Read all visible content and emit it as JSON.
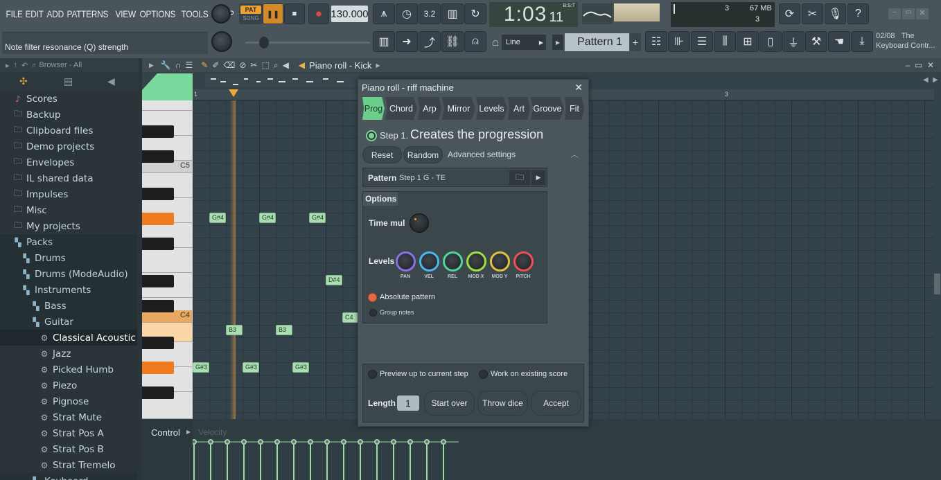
{
  "menu": [
    "FILE",
    "EDIT",
    "ADD",
    "PATTERNS",
    "VIEW",
    "OPTIONS",
    "TOOLS",
    "HELP"
  ],
  "transport": {
    "mode_pat": "PAT",
    "mode_song": "SONG",
    "tempo": "130.000",
    "time": "1:03",
    "time_small": "11",
    "bst": "B:S:T"
  },
  "monitor": {
    "cpu": "3",
    "memory": "67 MB",
    "polyphony": "3"
  },
  "hint": "Note filter resonance (Q) strength",
  "snap": "Line",
  "pattern": "Pattern 1",
  "news": {
    "date": "02/08",
    "line1": "The",
    "line2": "Keyboard Contr..."
  },
  "browser": {
    "header": "Browser - All",
    "items": [
      {
        "label": "Scores",
        "icon": "note-icon",
        "level": 0
      },
      {
        "label": "Backup",
        "icon": "folder-icon",
        "level": 0
      },
      {
        "label": "Clipboard files",
        "icon": "folder-icon",
        "level": 0
      },
      {
        "label": "Demo projects",
        "icon": "folder-icon",
        "level": 0
      },
      {
        "label": "Envelopes",
        "icon": "folder-icon",
        "level": 0
      },
      {
        "label": "IL shared data",
        "icon": "folder-icon",
        "level": 0
      },
      {
        "label": "Impulses",
        "icon": "folder-icon",
        "level": 0
      },
      {
        "label": "Misc",
        "icon": "folder-icon",
        "level": 0
      },
      {
        "label": "My projects",
        "icon": "folder-icon",
        "level": 0
      },
      {
        "label": "Packs",
        "icon": "pack-icon",
        "level": 0
      },
      {
        "label": "Drums",
        "icon": "pack-icon",
        "level": 1
      },
      {
        "label": "Drums (ModeAudio)",
        "icon": "pack-icon",
        "level": 1
      },
      {
        "label": "Instruments",
        "icon": "pack-icon",
        "level": 1
      },
      {
        "label": "Bass",
        "icon": "pack-icon",
        "level": 2
      },
      {
        "label": "Guitar",
        "icon": "pack-icon",
        "level": 2
      },
      {
        "label": "Classical Acoustic",
        "icon": "gear-icon",
        "level": 3
      },
      {
        "label": "Jazz",
        "icon": "gear-icon",
        "level": 3
      },
      {
        "label": "Picked Humb",
        "icon": "gear-icon",
        "level": 3
      },
      {
        "label": "Piezo",
        "icon": "gear-icon",
        "level": 3
      },
      {
        "label": "Pignose",
        "icon": "gear-icon",
        "level": 3
      },
      {
        "label": "Strat Mute",
        "icon": "gear-icon",
        "level": 3
      },
      {
        "label": "Strat Pos A",
        "icon": "gear-icon",
        "level": 3
      },
      {
        "label": "Strat Pos B",
        "icon": "gear-icon",
        "level": 3
      },
      {
        "label": "Strat Tremelo",
        "icon": "gear-icon",
        "level": 3
      },
      {
        "label": "Keyboard",
        "icon": "pack-icon",
        "level": 2
      }
    ]
  },
  "piano_roll": {
    "title": "Piano roll - Kick",
    "bar_labels": [
      "1",
      "3"
    ],
    "key_labels": [
      "C5",
      "C4"
    ],
    "notes": [
      {
        "label": "G#4"
      },
      {
        "label": "G#4"
      },
      {
        "label": "G#4"
      },
      {
        "label": "D#4"
      },
      {
        "label": "C4"
      },
      {
        "label": "B3"
      },
      {
        "label": "B3"
      },
      {
        "label": "G#3"
      },
      {
        "label": "G#3"
      },
      {
        "label": "G#3"
      }
    ],
    "control_label": "Control",
    "control_param": "Velocity"
  },
  "dialog": {
    "title": "Piano roll - riff machine",
    "tabs": [
      "Prog",
      "Chord",
      "Arp",
      "Mirror",
      "Levels",
      "Art",
      "Groove",
      "Fit"
    ],
    "step_label": "Step 1.",
    "step_title": "Creates the progression",
    "reset": "Reset",
    "random": "Random",
    "advanced": "Advanced settings",
    "pattern_label": "Pattern",
    "pattern_value": "Step 1 G - TE",
    "options_label": "Options",
    "time_mul": "Time mul",
    "levels_label": "Levels",
    "level_knobs": [
      {
        "label": "PAN",
        "color": "#8a6fe8"
      },
      {
        "label": "VEL",
        "color": "#49b7f0"
      },
      {
        "label": "REL",
        "color": "#4ed69a"
      },
      {
        "label": "MOD X",
        "color": "#9be03e"
      },
      {
        "label": "MOD Y",
        "color": "#e5c03a"
      },
      {
        "label": "PITCH",
        "color": "#f0504f"
      }
    ],
    "absolute_pattern": "Absolute pattern",
    "group_notes": "Group notes",
    "preview": "Preview up to current step",
    "work_existing": "Work on existing score",
    "length_label": "Length",
    "length_value": "1",
    "start_over": "Start over",
    "throw_dice": "Throw dice",
    "accept": "Accept"
  }
}
